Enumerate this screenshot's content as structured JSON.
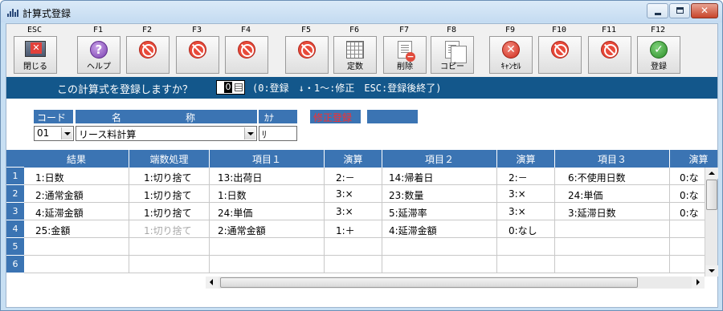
{
  "window": {
    "title": "計算式登録"
  },
  "toolbar": {
    "keys": [
      {
        "key": "ESC",
        "label": "閉じる",
        "icon": "close-window-icon"
      },
      {
        "key": "F1",
        "label": "ヘルプ",
        "icon": "help-icon",
        "glyph": "?"
      },
      {
        "key": "F2",
        "label": "",
        "icon": "no-entry-icon"
      },
      {
        "key": "F3",
        "label": "",
        "icon": "no-entry-icon"
      },
      {
        "key": "F4",
        "label": "",
        "icon": "no-entry-icon"
      },
      {
        "key": "F5",
        "label": "",
        "icon": "no-entry-icon"
      },
      {
        "key": "F6",
        "label": "定数",
        "icon": "table-icon"
      },
      {
        "key": "F7",
        "label": "削除",
        "icon": "delete-doc-icon"
      },
      {
        "key": "F8",
        "label": "コピー",
        "icon": "copy-icon"
      },
      {
        "key": "F9",
        "label": "ｷｬﾝｾﾙ",
        "icon": "cancel-icon",
        "glyph": "✕"
      },
      {
        "key": "F10",
        "label": "",
        "icon": "no-entry-icon"
      },
      {
        "key": "F11",
        "label": "",
        "icon": "no-entry-icon"
      },
      {
        "key": "F12",
        "label": "登録",
        "icon": "check-icon",
        "glyph": "✓"
      }
    ]
  },
  "prompt": {
    "question": "この計算式を登録しますか？",
    "value": "0",
    "hint": "(0:登録　↓・1～:修正　ESC:登録後終了)"
  },
  "selector": {
    "code_header": "コード",
    "name_header_1": "名",
    "name_header_2": "称",
    "kana_header": "ｶﾅ",
    "code_value": "01",
    "name_value": "リース料計算",
    "kana_value": "ﾘ",
    "mode_badge": "修正登録"
  },
  "grid": {
    "columns": [
      "結果",
      "端数処理",
      "項目１",
      "演算",
      "項目２",
      "演算",
      "項目３",
      "演算"
    ],
    "row_numbers": [
      "1",
      "2",
      "3",
      "4",
      "5",
      "6"
    ],
    "rows": [
      [
        "1:日数",
        "1:切り捨て",
        "13:出荷日",
        "2:－",
        "14:帰着日",
        "2:－",
        "6:不使用日数",
        "0:な"
      ],
      [
        "2:通常金額",
        "1:切り捨て",
        "1:日数",
        "3:×",
        "23:数量",
        "3:×",
        "24:単価",
        "0:な"
      ],
      [
        "4:延滞金額",
        "1:切り捨て",
        "24:単価",
        "3:×",
        "5:延滞率",
        "3:×",
        "3:延滞日数",
        "0:な"
      ],
      [
        "25:金額",
        "1:切り捨て",
        "2:通常金額",
        "1:＋",
        "4:延滞金額",
        "0:なし",
        "",
        ""
      ],
      [
        "",
        "",
        "",
        "",
        "",
        "",
        "",
        ""
      ],
      [
        "",
        "",
        "",
        "",
        "",
        "",
        "",
        ""
      ]
    ]
  },
  "colors": {
    "header_blue": "#3b74b3",
    "prompt_blue": "#13578b",
    "mode_red": "#ff2b2b"
  }
}
